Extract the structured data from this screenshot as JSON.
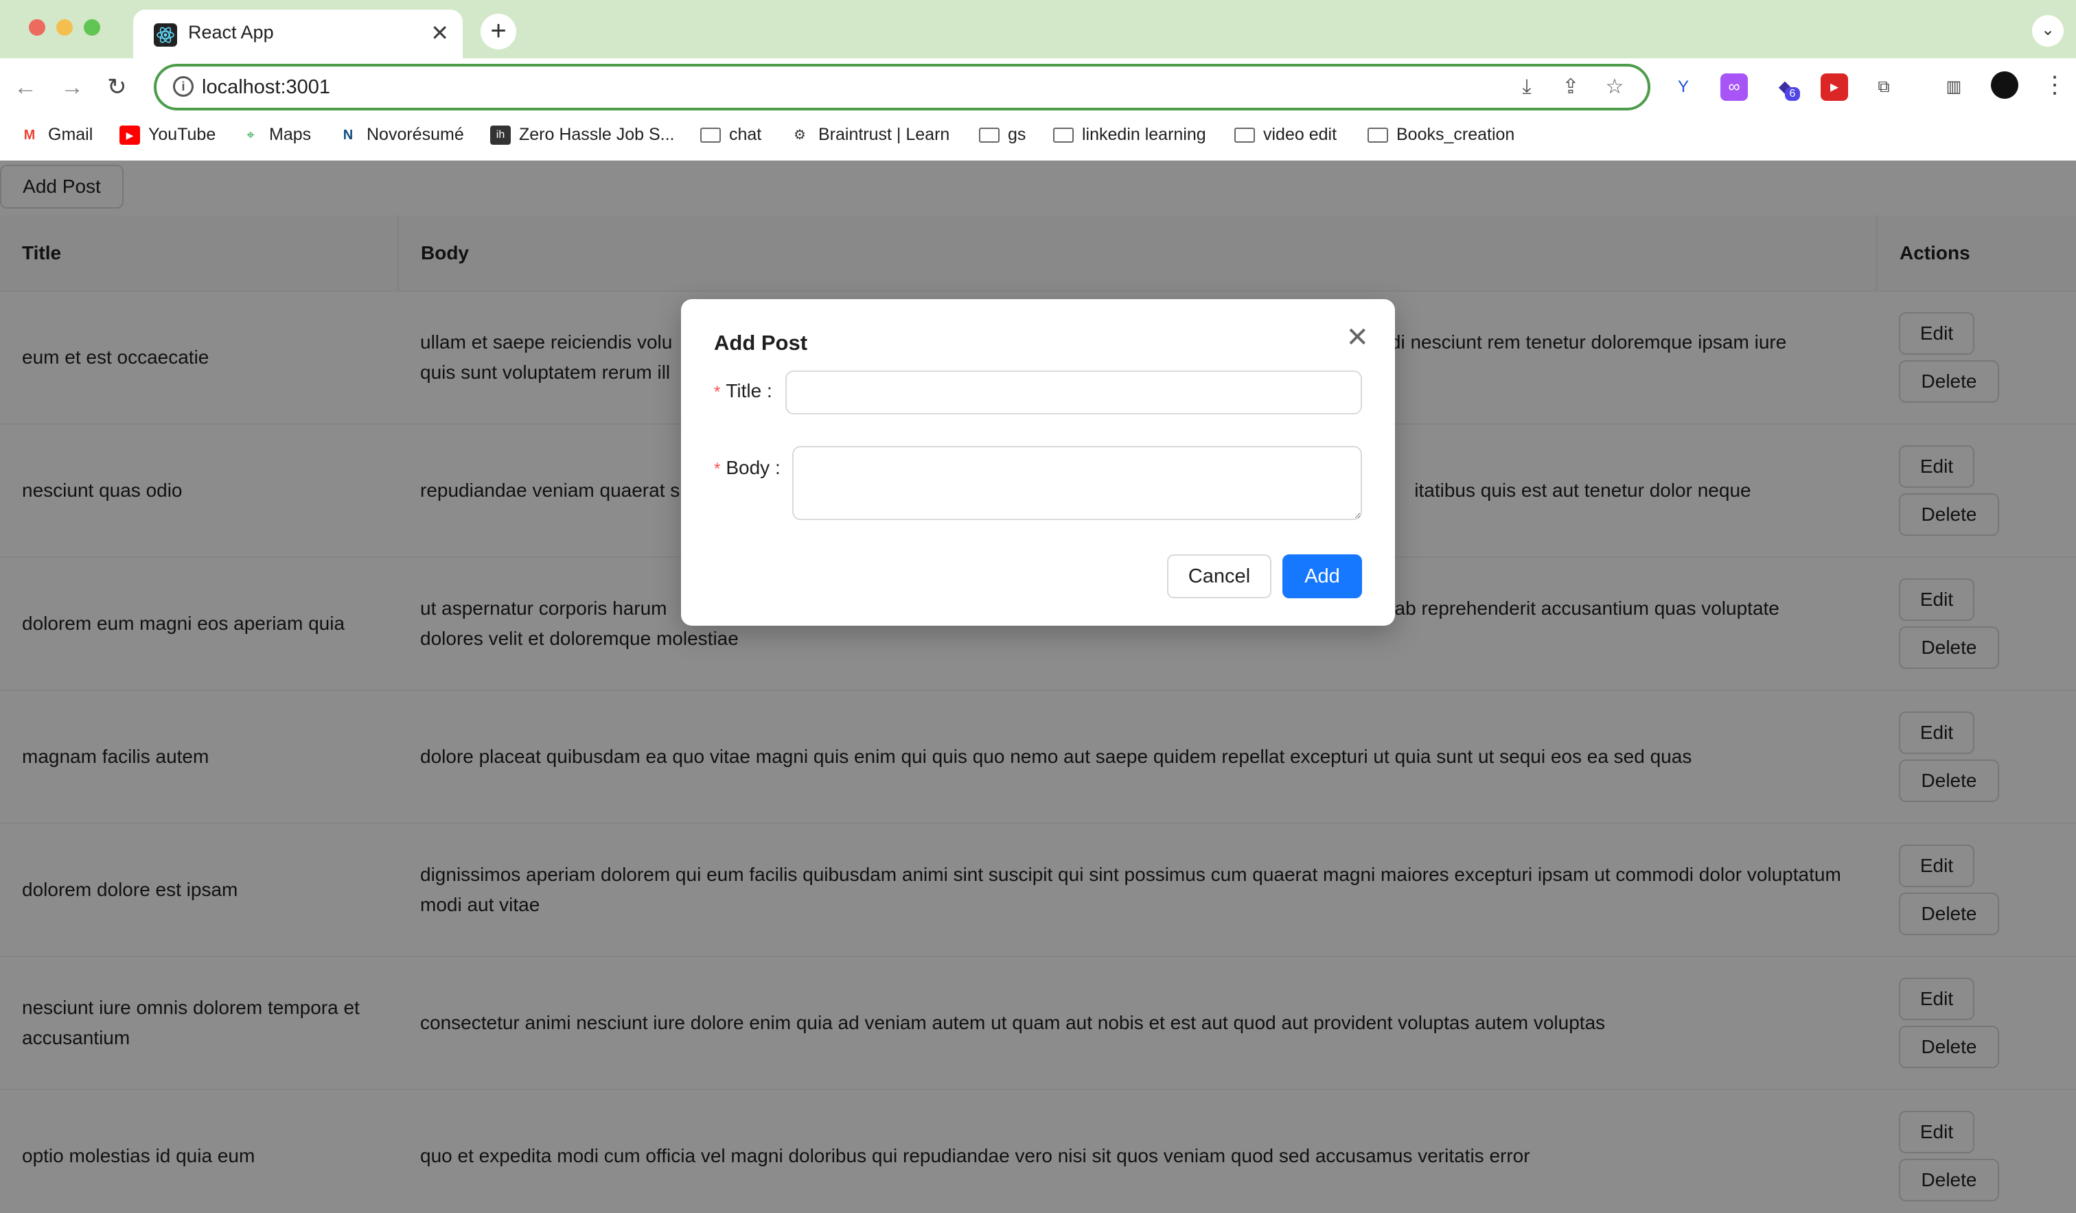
{
  "browser": {
    "tab_title": "React App",
    "url": "localhost:3001",
    "colors": {
      "tabbar": "#d3e8c9",
      "omnibox_border": "#4d9c4a"
    },
    "bookmarks": [
      {
        "label": "Gmail",
        "icon": "gmail-icon"
      },
      {
        "label": "YouTube",
        "icon": "youtube-icon"
      },
      {
        "label": "Maps",
        "icon": "maps-icon"
      },
      {
        "label": "Novorésumé",
        "icon": "novoresume-icon"
      },
      {
        "label": "Zero Hassle Job S...",
        "icon": "ih-icon"
      },
      {
        "label": "chat",
        "icon": "folder-icon"
      },
      {
        "label": "Braintrust | Learn",
        "icon": "gear-icon"
      },
      {
        "label": "gs",
        "icon": "folder-icon"
      },
      {
        "label": "linkedin learning",
        "icon": "folder-icon"
      },
      {
        "label": "video edit",
        "icon": "folder-icon"
      },
      {
        "label": "Books_creation",
        "icon": "folder-icon"
      }
    ],
    "extension_badge": "6"
  },
  "page": {
    "add_post_label": "Add Post",
    "table": {
      "headers": {
        "title": "Title",
        "body": "Body",
        "actions": "Actions"
      },
      "edit_label": "Edit",
      "delete_label": "Delete",
      "rows": [
        {
          "title": "eum et est occaecatie",
          "body_left": "ullam et saepe reiciendis volu",
          "body_right": "odi nesciunt rem tenetur doloremque ipsam iure",
          "body_line2": "quis sunt voluptatem rerum ill"
        },
        {
          "title": "nesciunt quas odio",
          "body_left": "repudiandae veniam quaerat s",
          "body_right": "itatibus quis est aut tenetur dolor neque",
          "body_line2": ""
        },
        {
          "title": "dolorem eum magni eos aperiam quia",
          "body_left": "ut aspernatur corporis harum",
          "body_right": "ab reprehenderit accusantium quas voluptate",
          "body_line2": "dolores velit et doloremque molestiae"
        },
        {
          "title": "magnam facilis autem",
          "body_full": "dolore placeat quibusdam ea quo vitae magni quis enim qui quis quo nemo aut saepe quidem repellat excepturi ut quia sunt ut sequi eos ea sed quas"
        },
        {
          "title": "dolorem dolore est ipsam",
          "body_full": "dignissimos aperiam dolorem qui eum facilis quibusdam animi sint suscipit qui sint possimus cum quaerat magni maiores excepturi ipsam ut commodi dolor voluptatum modi aut vitae"
        },
        {
          "title": "nesciunt iure omnis dolorem tempora et accusantium",
          "body_full": "consectetur animi nesciunt iure dolore enim quia ad veniam autem ut quam aut nobis et est aut quod aut provident voluptas autem voluptas"
        },
        {
          "title": "optio molestias id quia eum",
          "body_full": "quo et expedita modi cum officia vel magni doloribus qui repudiandae vero nisi sit quos veniam quod sed accusamus veritatis error"
        }
      ]
    }
  },
  "modal": {
    "title": "Add Post",
    "title_label": "Title",
    "body_label": "Body",
    "title_value": "",
    "body_value": "",
    "cancel_label": "Cancel",
    "add_label": "Add",
    "colors": {
      "primary": "#1677ff",
      "required": "#ff4d4f"
    }
  }
}
